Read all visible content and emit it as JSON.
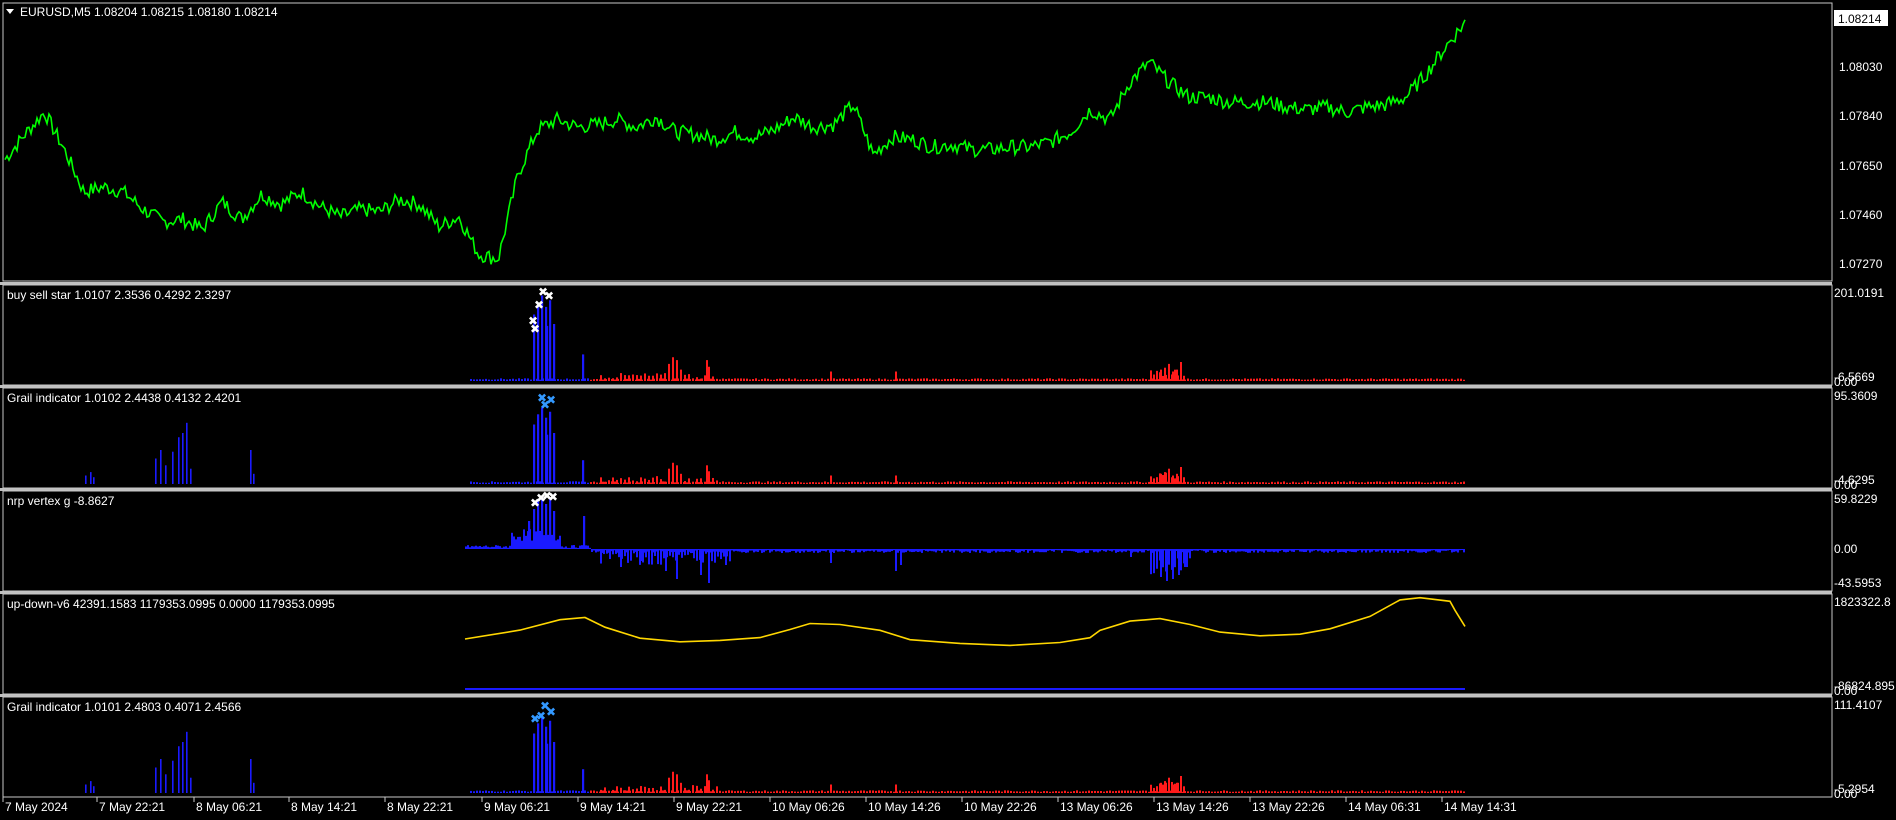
{
  "colors": {
    "background": "#000000",
    "frame": "#c8c8c8",
    "separator": "#c0c0c0",
    "price_line": "#00ff00",
    "text": "#ffffff",
    "bull": "#1a1aff",
    "bear": "#ff1a1a",
    "yellow": "#ffd700",
    "marker_white": "#ffffff",
    "marker_blue": "#3399ff"
  },
  "main": {
    "title": "EURUSD,M5  1.08204 1.08215 1.08180 1.08214",
    "current_price": "1.08214",
    "price_ticks": [
      "1.08030",
      "1.07840",
      "1.07650",
      "1.07460",
      "1.07270"
    ]
  },
  "panels": [
    {
      "title": "buy sell star 1.0107 2.3536 0.4292 2.3297",
      "max": "201.0191",
      "min": "-6.5669",
      "zero": "0.00",
      "markers": "white"
    },
    {
      "title": "Grail indicator 1.0102 2.4438 0.4132 2.4201",
      "max": "95.3609",
      "min": "-4.6295",
      "zero": "0.00",
      "markers": "blue"
    },
    {
      "title": "nrp vertex g -8.8627",
      "max": "59.8229",
      "mid": "0.00",
      "min": "-43.5953",
      "markers": "white"
    },
    {
      "title": "up-down-v6 42391.1583 1179353.0995 0.0000 1179353.0995",
      "max": "1823322.8",
      "min": "-86824.895",
      "zero": "0.00"
    },
    {
      "title": "Grail indicator 1.0101 2.4803 0.4071 2.4566",
      "max": "111.4107",
      "min": "-5.2954",
      "zero": "0.00",
      "markers": "blue"
    }
  ],
  "time_axis": [
    "7 May 2024",
    "7 May 22:21",
    "8 May 06:21",
    "8 May 14:21",
    "8 May 22:21",
    "9 May 06:21",
    "9 May 14:21",
    "9 May 22:21",
    "10 May 06:26",
    "10 May 14:26",
    "10 May 22:26",
    "13 May 06:26",
    "13 May 14:26",
    "13 May 22:26",
    "14 May 06:31",
    "14 May 14:31"
  ],
  "chart_data": {
    "type": "line",
    "symbol": "EURUSD",
    "timeframe": "M5",
    "ylim": [
      1.0718,
      1.0828
    ],
    "series": [
      {
        "values": [
          1.0766,
          1.0776,
          1.0785,
          1.077,
          1.0753,
          1.0755,
          1.0753,
          1.0746,
          1.0741,
          1.0742,
          1.0738,
          1.0749,
          1.0742,
          1.0752,
          1.0748,
          1.0753,
          1.0747,
          1.0743,
          1.0746,
          1.0745,
          1.075,
          1.0748,
          1.0739,
          1.0743,
          1.0728,
          1.0726,
          1.076,
          1.0778,
          1.0782,
          1.0779,
          1.078,
          1.0782,
          1.0779,
          1.0783,
          1.0777,
          1.0776,
          1.0774,
          1.0777,
          1.0775,
          1.0778,
          1.0783,
          1.0779,
          1.078,
          1.0788,
          1.0768,
          1.0775,
          1.0774,
          1.0771,
          1.0772,
          1.077,
          1.077,
          1.0771,
          1.0771,
          1.0773,
          1.0777,
          1.0786,
          1.0782,
          1.0797,
          1.0805,
          1.0797,
          1.0791,
          1.0791,
          1.0789,
          1.0789,
          1.0789,
          1.0787,
          1.0786,
          1.0787,
          1.0785,
          1.0787,
          1.0788,
          1.0791,
          1.08,
          1.0811,
          1.0821
        ]
      }
    ]
  }
}
